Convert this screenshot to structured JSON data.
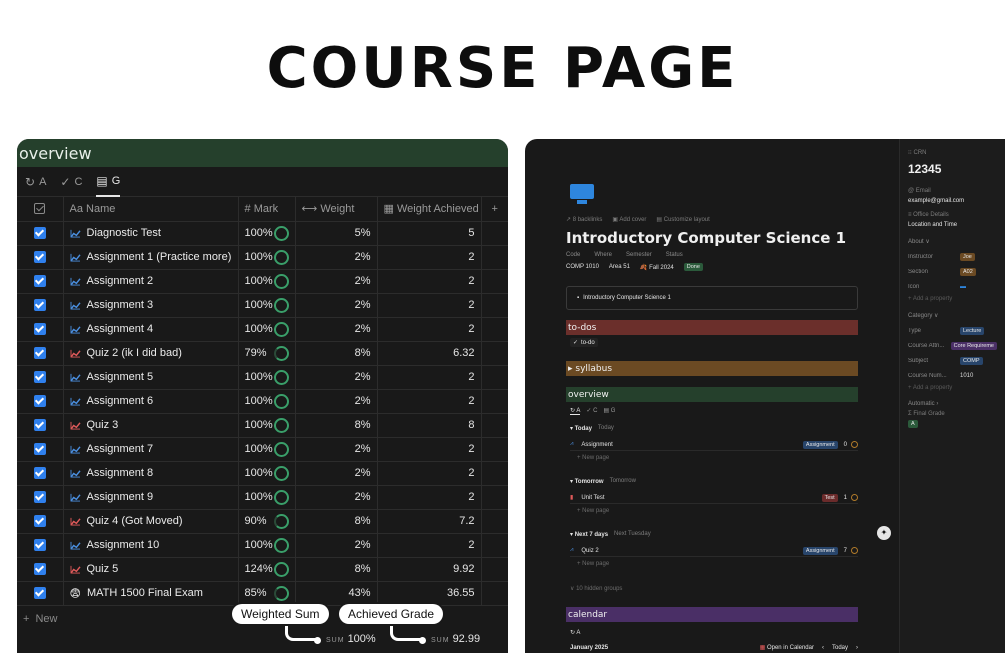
{
  "hero": {
    "title": "COURSE PAGE"
  },
  "left": {
    "header": "overview",
    "tabs": [
      {
        "label": "A"
      },
      {
        "label": "C"
      },
      {
        "label": "G"
      }
    ],
    "columns": {
      "name": "Name",
      "mark": "Mark",
      "weight": "Weight",
      "weight_achieved": "Weight Achieved",
      "name_prefix": "Aa",
      "mark_prefix": "#"
    },
    "rows": [
      {
        "name": "Diagnostic Test",
        "mark": "100%",
        "weight": "5%",
        "achieved": "5",
        "trend": "up"
      },
      {
        "name": "Assignment 1 (Practice more)",
        "mark": "100%",
        "weight": "2%",
        "achieved": "2",
        "trend": "up"
      },
      {
        "name": "Assignment 2",
        "mark": "100%",
        "weight": "2%",
        "achieved": "2",
        "trend": "up"
      },
      {
        "name": "Assignment 3",
        "mark": "100%",
        "weight": "2%",
        "achieved": "2",
        "trend": "up"
      },
      {
        "name": "Assignment 4",
        "mark": "100%",
        "weight": "2%",
        "achieved": "2",
        "trend": "up"
      },
      {
        "name": "Quiz 2 (ik I did bad)",
        "mark": "79%",
        "weight": "8%",
        "achieved": "6.32",
        "trend": "quiz"
      },
      {
        "name": "Assignment 5",
        "mark": "100%",
        "weight": "2%",
        "achieved": "2",
        "trend": "up"
      },
      {
        "name": "Assignment 6",
        "mark": "100%",
        "weight": "2%",
        "achieved": "2",
        "trend": "up"
      },
      {
        "name": "Quiz 3",
        "mark": "100%",
        "weight": "8%",
        "achieved": "8",
        "trend": "quiz"
      },
      {
        "name": "Assignment 7",
        "mark": "100%",
        "weight": "2%",
        "achieved": "2",
        "trend": "up"
      },
      {
        "name": "Assignment 8",
        "mark": "100%",
        "weight": "2%",
        "achieved": "2",
        "trend": "up"
      },
      {
        "name": "Assignment 9",
        "mark": "100%",
        "weight": "2%",
        "achieved": "2",
        "trend": "up"
      },
      {
        "name": "Quiz 4 (Got Moved)",
        "mark": "90%",
        "weight": "8%",
        "achieved": "7.2",
        "trend": "quiz"
      },
      {
        "name": "Assignment 10",
        "mark": "100%",
        "weight": "2%",
        "achieved": "2",
        "trend": "up"
      },
      {
        "name": "Quiz 5",
        "mark": "124%",
        "weight": "8%",
        "achieved": "9.92",
        "trend": "quiz"
      },
      {
        "name": "MATH 1500 Final Exam",
        "mark": "85%",
        "weight": "43%",
        "achieved": "36.55",
        "trend": "exam"
      }
    ],
    "new_label": "New",
    "sum": {
      "label": "SUM",
      "weight": "100%",
      "achieved": "92.99"
    },
    "colors": {
      "up": "#4a8fe0",
      "quiz": "#e05a5a",
      "ring": "#3a9f6a"
    }
  },
  "callouts": {
    "weighted_sum": "Weighted Sum",
    "achieved_grade": "Achieved Grade"
  },
  "right": {
    "meta": [
      "8 backlinks",
      "Add cover",
      "Customize layout"
    ],
    "title": "Introductory Computer Science 1",
    "prop_labels": [
      "Code",
      "Where",
      "Semester",
      "Status"
    ],
    "prop_values": {
      "code": "COMP 1010",
      "where": "Area 51",
      "semester": "Fall 2024",
      "status": "Done"
    },
    "link_card": "Introductory Computer Science 1",
    "sections": {
      "todos": "to-dos",
      "todo_item": "to-do",
      "syllabus": "syllabus",
      "overview": "overview",
      "calendar": "calendar"
    },
    "mini_tabs": [
      "A",
      "C",
      "G"
    ],
    "groups": [
      {
        "title": "Today",
        "sub": "Today",
        "item": "Assignment",
        "tag": "Assignment",
        "num": "0"
      },
      {
        "title": "Tomorrow",
        "sub": "Tomorrow",
        "item": "Unit Test",
        "tag": "Test",
        "num": "1"
      },
      {
        "title": "Next 7 days",
        "sub": "Next Tuesday",
        "item": "Quiz 2",
        "tag": "Assignment",
        "num": "7"
      }
    ],
    "new_page": "New page",
    "hidden_groups": "10 hidden groups",
    "cal_tab": "A",
    "cal_month": "January 2025",
    "cal_open": "Open in Calendar",
    "cal_today": "Today",
    "side": {
      "crn_label": "CRN",
      "crn": "12345",
      "email_label": "Email",
      "email": "example@gmail.com",
      "office_label": "Office Details",
      "office": "Location and Time",
      "about": "About",
      "props": [
        {
          "k": "Instructor",
          "v": "Joe",
          "c": "orange"
        },
        {
          "k": "Section",
          "v": "A02",
          "c": "orange"
        },
        {
          "k": "Icon",
          "v": "",
          "c": "blue"
        }
      ],
      "add_prop": "Add a property",
      "category": "Category",
      "cat_props": [
        {
          "k": "Type",
          "v": "Lecture",
          "c": "blue"
        },
        {
          "k": "Course Attri...",
          "v": "Core Requireme",
          "c": "purple"
        },
        {
          "k": "Subject",
          "v": "COMP",
          "c": "blue"
        },
        {
          "k": "Course Num...",
          "v": "1010",
          "c": ""
        }
      ],
      "automatic": "Automatic",
      "final_grade_label": "Final Grade",
      "final_grade": "A"
    }
  }
}
